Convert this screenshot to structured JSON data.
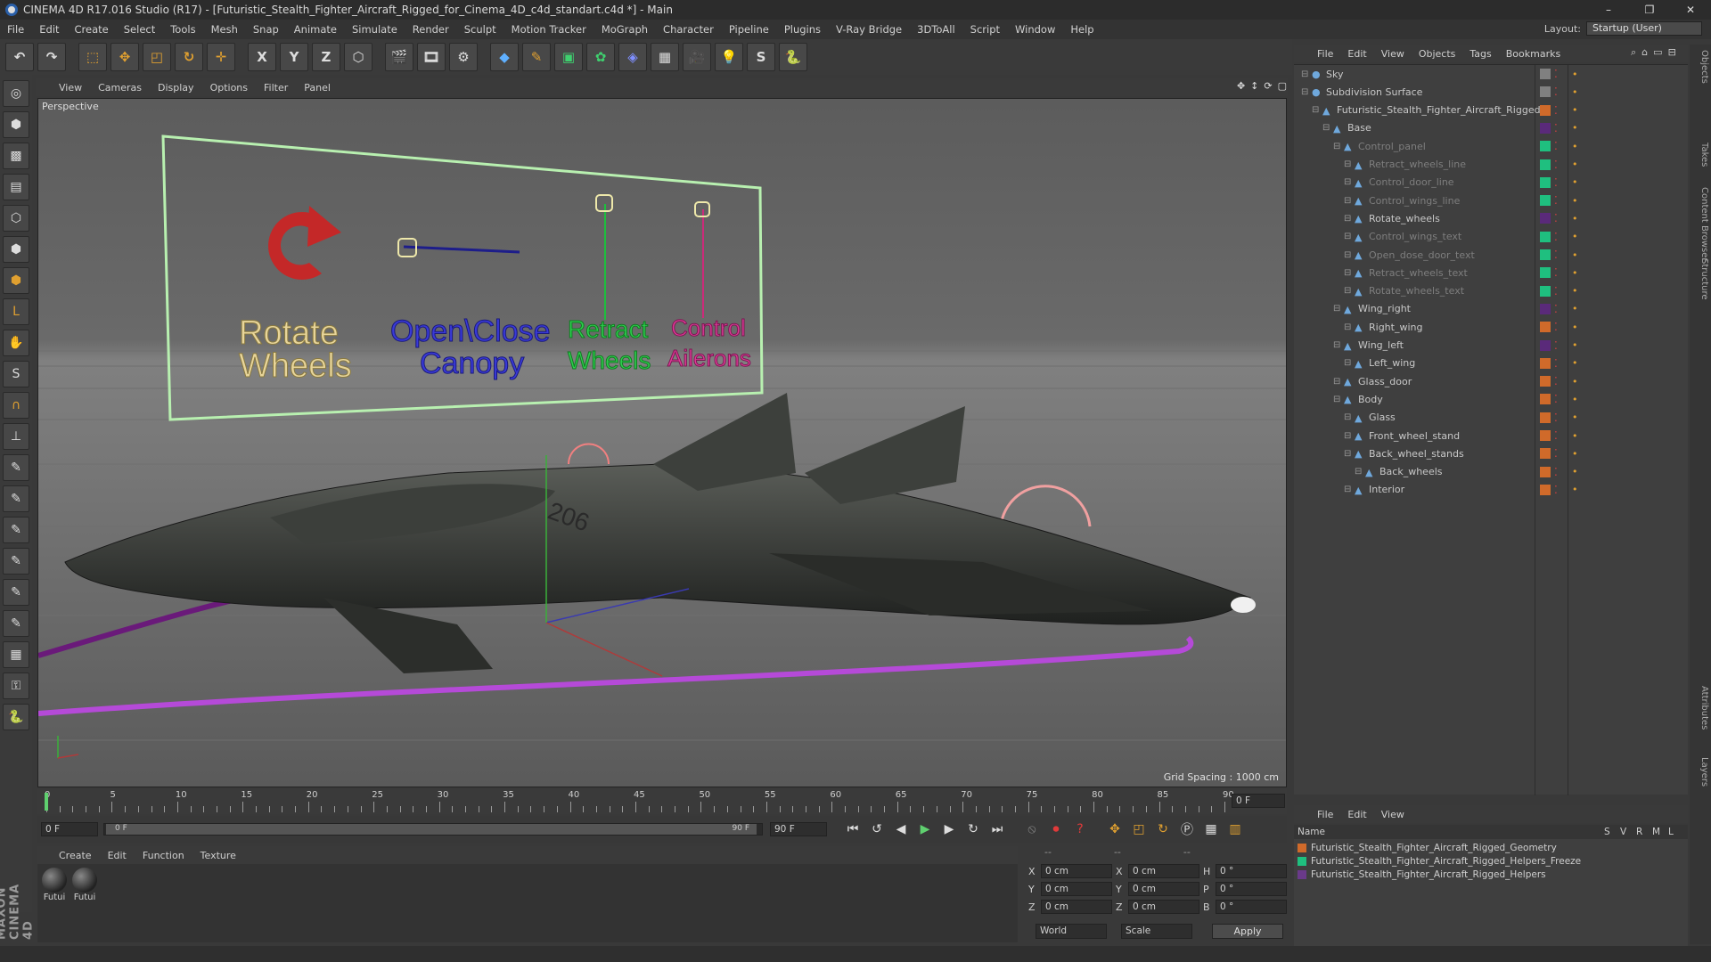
{
  "window": {
    "title": "CINEMA 4D R17.016 Studio (R17) - [Futuristic_Stealth_Fighter_Aircraft_Rigged_for_Cinema_4D_c4d_standart.c4d *] - Main"
  },
  "menu": [
    "File",
    "Edit",
    "Create",
    "Select",
    "Tools",
    "Mesh",
    "Snap",
    "Animate",
    "Simulate",
    "Render",
    "Sculpt",
    "Motion Tracker",
    "MoGraph",
    "Character",
    "Pipeline",
    "Plugins",
    "V-Ray Bridge",
    "3DToAll",
    "Script",
    "Window",
    "Help"
  ],
  "layout": {
    "label": "Layout:",
    "value": "Startup (User)"
  },
  "toolbar": {
    "x": "X",
    "y": "Y",
    "z": "Z"
  },
  "left_tools": {
    "s": "S"
  },
  "maxon": "MAXON CINEMA 4D",
  "viewport": {
    "menu": [
      "View",
      "Cameras",
      "Display",
      "Options",
      "Filter",
      "Panel"
    ],
    "label": "Perspective",
    "grid_spacing": "Grid Spacing : 1000 cm",
    "panel_texts": {
      "rotate": [
        "Rotate",
        "Wheels"
      ],
      "canopy": [
        "Open\\Close",
        "Canopy"
      ],
      "retract": [
        "Retract",
        "Wheels"
      ],
      "control": [
        "Control",
        "Ailerons"
      ]
    }
  },
  "timeline": {
    "ticks": [
      "0",
      "5",
      "10",
      "15",
      "20",
      "25",
      "30",
      "35",
      "40",
      "45",
      "50",
      "55",
      "60",
      "65",
      "70",
      "75",
      "80",
      "85",
      "90"
    ],
    "current_frame": "0 F",
    "start": "0 F",
    "range_start": "0 F",
    "range_end": "90 F",
    "end": "90 F"
  },
  "material_manager": {
    "menu": [
      "Create",
      "Edit",
      "Function",
      "Texture"
    ],
    "materials": [
      "Futui",
      "Futui"
    ]
  },
  "coordinates": {
    "header": [
      "--",
      "--",
      "--"
    ],
    "rows": [
      {
        "axis": "X",
        "pos": "0 cm",
        "size_axis": "X",
        "size": "0 cm",
        "rot_axis": "H",
        "rot": "0 °"
      },
      {
        "axis": "Y",
        "pos": "0 cm",
        "size_axis": "Y",
        "size": "0 cm",
        "rot_axis": "P",
        "rot": "0 °"
      },
      {
        "axis": "Z",
        "pos": "0 cm",
        "size_axis": "Z",
        "size": "0 cm",
        "rot_axis": "B",
        "rot": "0 °"
      }
    ],
    "mode": "World",
    "transform": "Scale",
    "apply": "Apply"
  },
  "object_manager": {
    "menu": [
      "File",
      "Edit",
      "View",
      "Objects",
      "Tags",
      "Bookmarks"
    ],
    "objects": [
      {
        "name": "Sky",
        "indent": 0,
        "dim": false,
        "color": "#808080"
      },
      {
        "name": "Subdivision Surface",
        "indent": 0,
        "dim": false,
        "color": "#808080"
      },
      {
        "name": "Futuristic_Stealth_Fighter_Aircraft_Rigged",
        "indent": 1,
        "dim": false,
        "color": "#d06a2a"
      },
      {
        "name": "Base",
        "indent": 2,
        "dim": false,
        "color": "#5a2a7a"
      },
      {
        "name": "Control_panel",
        "indent": 3,
        "dim": true,
        "color": "#1fbf7f"
      },
      {
        "name": "Retract_wheels_line",
        "indent": 4,
        "dim": true,
        "color": "#1fbf7f"
      },
      {
        "name": "Control_door_line",
        "indent": 4,
        "dim": true,
        "color": "#1fbf7f"
      },
      {
        "name": "Control_wings_line",
        "indent": 4,
        "dim": true,
        "color": "#1fbf7f"
      },
      {
        "name": "Rotate_wheels",
        "indent": 4,
        "dim": false,
        "color": "#5a2a7a"
      },
      {
        "name": "Control_wings_text",
        "indent": 4,
        "dim": true,
        "color": "#1fbf7f"
      },
      {
        "name": "Open_dose_door_text",
        "indent": 4,
        "dim": true,
        "color": "#1fbf7f"
      },
      {
        "name": "Retract_wheels_text",
        "indent": 4,
        "dim": true,
        "color": "#1fbf7f"
      },
      {
        "name": "Rotate_wheels_text",
        "indent": 4,
        "dim": true,
        "color": "#1fbf7f"
      },
      {
        "name": "Wing_right",
        "indent": 3,
        "dim": false,
        "color": "#5a2a7a"
      },
      {
        "name": "Right_wing",
        "indent": 4,
        "dim": false,
        "color": "#d06a2a"
      },
      {
        "name": "Wing_left",
        "indent": 3,
        "dim": false,
        "color": "#5a2a7a"
      },
      {
        "name": "Left_wing",
        "indent": 4,
        "dim": false,
        "color": "#d06a2a"
      },
      {
        "name": "Glass_door",
        "indent": 3,
        "dim": false,
        "color": "#d06a2a"
      },
      {
        "name": "Body",
        "indent": 3,
        "dim": false,
        "color": "#d06a2a"
      },
      {
        "name": "Glass",
        "indent": 4,
        "dim": false,
        "color": "#d06a2a"
      },
      {
        "name": "Front_wheel_stand",
        "indent": 4,
        "dim": false,
        "color": "#d06a2a"
      },
      {
        "name": "Back_wheel_stands",
        "indent": 4,
        "dim": false,
        "color": "#d06a2a"
      },
      {
        "name": "Back_wheels",
        "indent": 5,
        "dim": false,
        "color": "#d06a2a"
      },
      {
        "name": "Interior",
        "indent": 4,
        "dim": false,
        "color": "#d06a2a"
      }
    ]
  },
  "layer_manager": {
    "menu": [
      "File",
      "Edit",
      "View"
    ],
    "columns": {
      "name": "Name",
      "s": "S",
      "v": "V",
      "r": "R",
      "m": "M",
      "l": "L"
    },
    "layers": [
      {
        "name": "Futuristic_Stealth_Fighter_Aircraft_Rigged_Geometry",
        "color": "#d06a2a"
      },
      {
        "name": "Futuristic_Stealth_Fighter_Aircraft_Rigged_Helpers_Freeze",
        "color": "#1fbf7f"
      },
      {
        "name": "Futuristic_Stealth_Fighter_Aircraft_Rigged_Helpers",
        "color": "#6a3a8a"
      }
    ]
  },
  "vertical_tabs": [
    "Objects",
    "Takes",
    "Content Browser",
    "Structure",
    "Attributes",
    "Layers"
  ]
}
